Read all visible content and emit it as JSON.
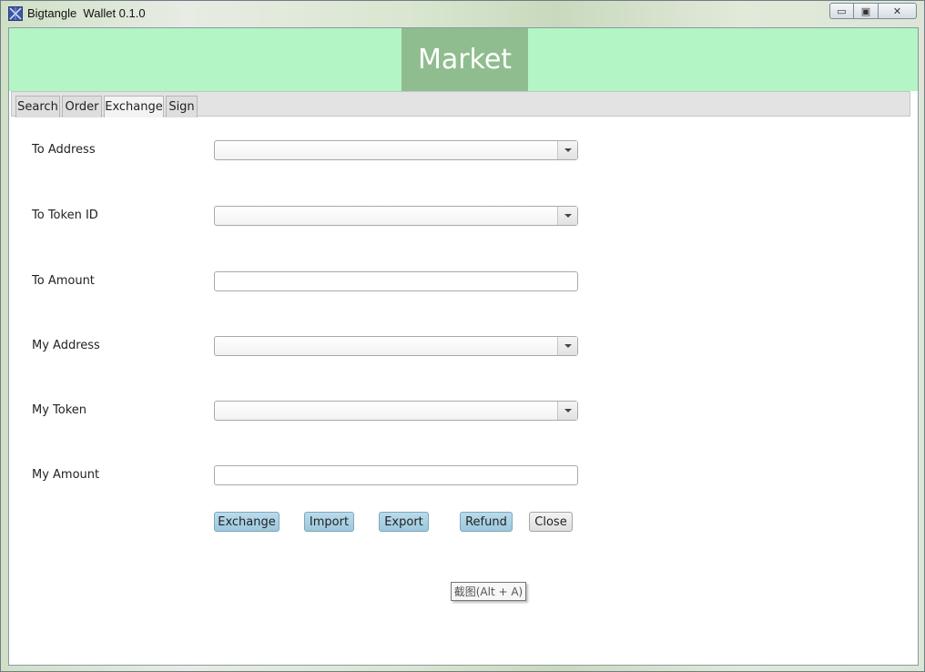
{
  "window": {
    "title": "Bigtangle  Wallet 0.1.0",
    "icon": "app-logo-icon",
    "controls": {
      "minimize": "▭",
      "maximize": "▣",
      "close": "✕"
    }
  },
  "header": {
    "title": "Market",
    "band_color": "#b3f5c5",
    "title_bg": "#8fbd8f"
  },
  "tabs": [
    {
      "label": "Search",
      "selected": false
    },
    {
      "label": "Order",
      "selected": false
    },
    {
      "label": "Exchange",
      "selected": true
    },
    {
      "label": "Sign",
      "selected": false
    }
  ],
  "form": {
    "to_address": {
      "label": "To Address",
      "value": ""
    },
    "to_token_id": {
      "label": "To Token ID",
      "value": ""
    },
    "to_amount": {
      "label": "To Amount",
      "value": ""
    },
    "my_address": {
      "label": "My Address",
      "value": ""
    },
    "my_token": {
      "label": "My Token",
      "value": ""
    },
    "my_amount": {
      "label": "My Amount",
      "value": ""
    }
  },
  "buttons": {
    "exchange": "Exchange",
    "import": "Import",
    "export": "Export",
    "refund": "Refund",
    "close": "Close"
  },
  "tooltip": {
    "text": "截图(Alt + A)"
  },
  "colors": {
    "accent_button": "#9cc8dc"
  }
}
